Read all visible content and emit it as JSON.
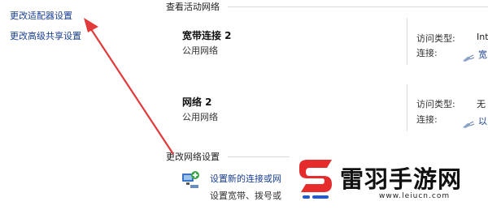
{
  "sidebar": {
    "links": [
      {
        "label": "更改适配器设置"
      },
      {
        "label": "更改高级共享设置"
      }
    ]
  },
  "active_networks": {
    "title": "查看活动网络",
    "items": [
      {
        "name": "宽带连接  2",
        "type": "公用网络",
        "access_label": "访问类型:",
        "access_value": "Int",
        "conn_label": "连接:",
        "conn_value": "宽"
      },
      {
        "name": "网络  2",
        "type": "公用网络",
        "access_label": "访问类型:",
        "access_value": "无",
        "conn_label": "连接:",
        "conn_value": "以"
      }
    ]
  },
  "change_settings": {
    "title": "更改网络设置",
    "setup_link": "设置新的连接或网",
    "setup_desc": "设置宽带、拨号或"
  },
  "watermark": {
    "text": "雷羽手游网",
    "url": "www.leiucn.com",
    "colors": {
      "red": "#e52b2b",
      "blue": "#1e5ad8"
    }
  },
  "annotation": {
    "arrow_color": "#e23a3a"
  }
}
